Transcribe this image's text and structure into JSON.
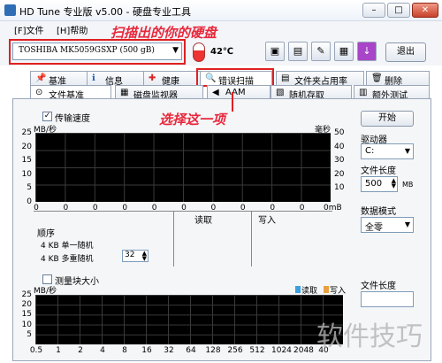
{
  "window": {
    "title": "HD Tune 专业版 v5.00 - 硬盘专业工具",
    "controls": {
      "minimize": "–",
      "maximize": "□",
      "close": "✕"
    }
  },
  "menu": {
    "file": "[F]文件",
    "help": "[H]帮助"
  },
  "toolbar": {
    "drive": "TOSHIBA MK5059GSXP (500 gB)",
    "temperature": "42℃",
    "exit": "退出"
  },
  "annotations": {
    "drive_note": "扫描出的你的硬盘",
    "tab_note": "选择这一项"
  },
  "tabs": {
    "row1": [
      "基准",
      "信息",
      "健康",
      "错误扫描",
      "文件夹占用率",
      "删除"
    ],
    "row2": [
      "文件基准",
      "磁盘监视器",
      "AAM",
      "随机存取",
      "额外测试"
    ]
  },
  "top_graph": {
    "checkbox_label": "传输速度",
    "unit_left": "MB/秒",
    "unit_right": "毫秒",
    "y_left": [
      "25",
      "20",
      "15",
      "10",
      "5",
      "0"
    ],
    "y_right": [
      "50",
      "40",
      "30",
      "20",
      "10"
    ],
    "x_ticks": [
      "0",
      "0",
      "0",
      "0",
      "0",
      "0",
      "0",
      "0",
      "0",
      "0",
      "0mB"
    ]
  },
  "results_table": {
    "headers": {
      "order": "顺序",
      "read": "读取",
      "write": "写入"
    },
    "rows": [
      "4 KB 单一随机",
      "4 KB 多重随机"
    ],
    "queue_value": "32"
  },
  "bottom_graph": {
    "checkbox_label": "测量块大小",
    "unit": "MB/秒",
    "legend_read": "读取",
    "legend_write": "写入",
    "y_ticks": [
      "25",
      "20",
      "15",
      "10",
      "5"
    ],
    "x_ticks": [
      "0.5",
      "1",
      "2",
      "4",
      "8",
      "16",
      "32",
      "64",
      "128",
      "256",
      "512",
      "1024",
      "2048",
      "40"
    ]
  },
  "side_panel": {
    "start": "开始",
    "drive_label": "驱动器",
    "drive_value": "C:",
    "file_length_label": "文件长度",
    "file_length_value": "500",
    "file_length_unit": "MB",
    "data_mode_label": "数据模式",
    "data_mode_value": "全零",
    "file_length_label2": "文件长度"
  },
  "watermark": "软件技巧",
  "colors": {
    "annotation": "#e8283c",
    "legend_read": "#3aa0e0",
    "legend_write": "#e8a040"
  }
}
